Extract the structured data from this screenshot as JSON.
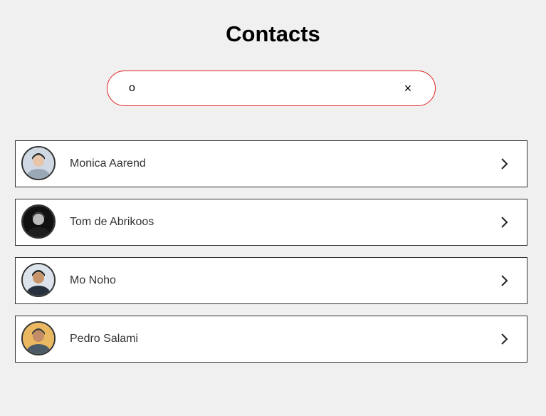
{
  "header": {
    "title": "Contacts"
  },
  "search": {
    "value": "o",
    "clear_glyph": "×"
  },
  "contacts": [
    {
      "name": "Monica Aarend",
      "avatar_icon": "person-photo-icon",
      "bg": "#cfd8e3",
      "skin": "#e8c4a8",
      "hair": "#2a2a2a",
      "shirt": "#9aa7b4"
    },
    {
      "name": "Tom de Abrikoos",
      "avatar_icon": "person-photo-icon",
      "bg": "#111111",
      "skin": "#bdbdbd",
      "hair": "#3a3a3a",
      "shirt": "#1e1e1e"
    },
    {
      "name": "Mo Noho",
      "avatar_icon": "person-photo-icon",
      "bg": "#dce3ea",
      "skin": "#c8956b",
      "hair": "#1c1c1c",
      "shirt": "#26313d"
    },
    {
      "name": "Pedro Salami",
      "avatar_icon": "person-photo-icon",
      "bg": "#e9b860",
      "skin": "#c28d68",
      "hair": "#3b3b3b",
      "shirt": "#4a5a66"
    }
  ],
  "colors": {
    "search_border": "#e02020",
    "row_border": "#333333",
    "background": "#f0f0f0"
  }
}
